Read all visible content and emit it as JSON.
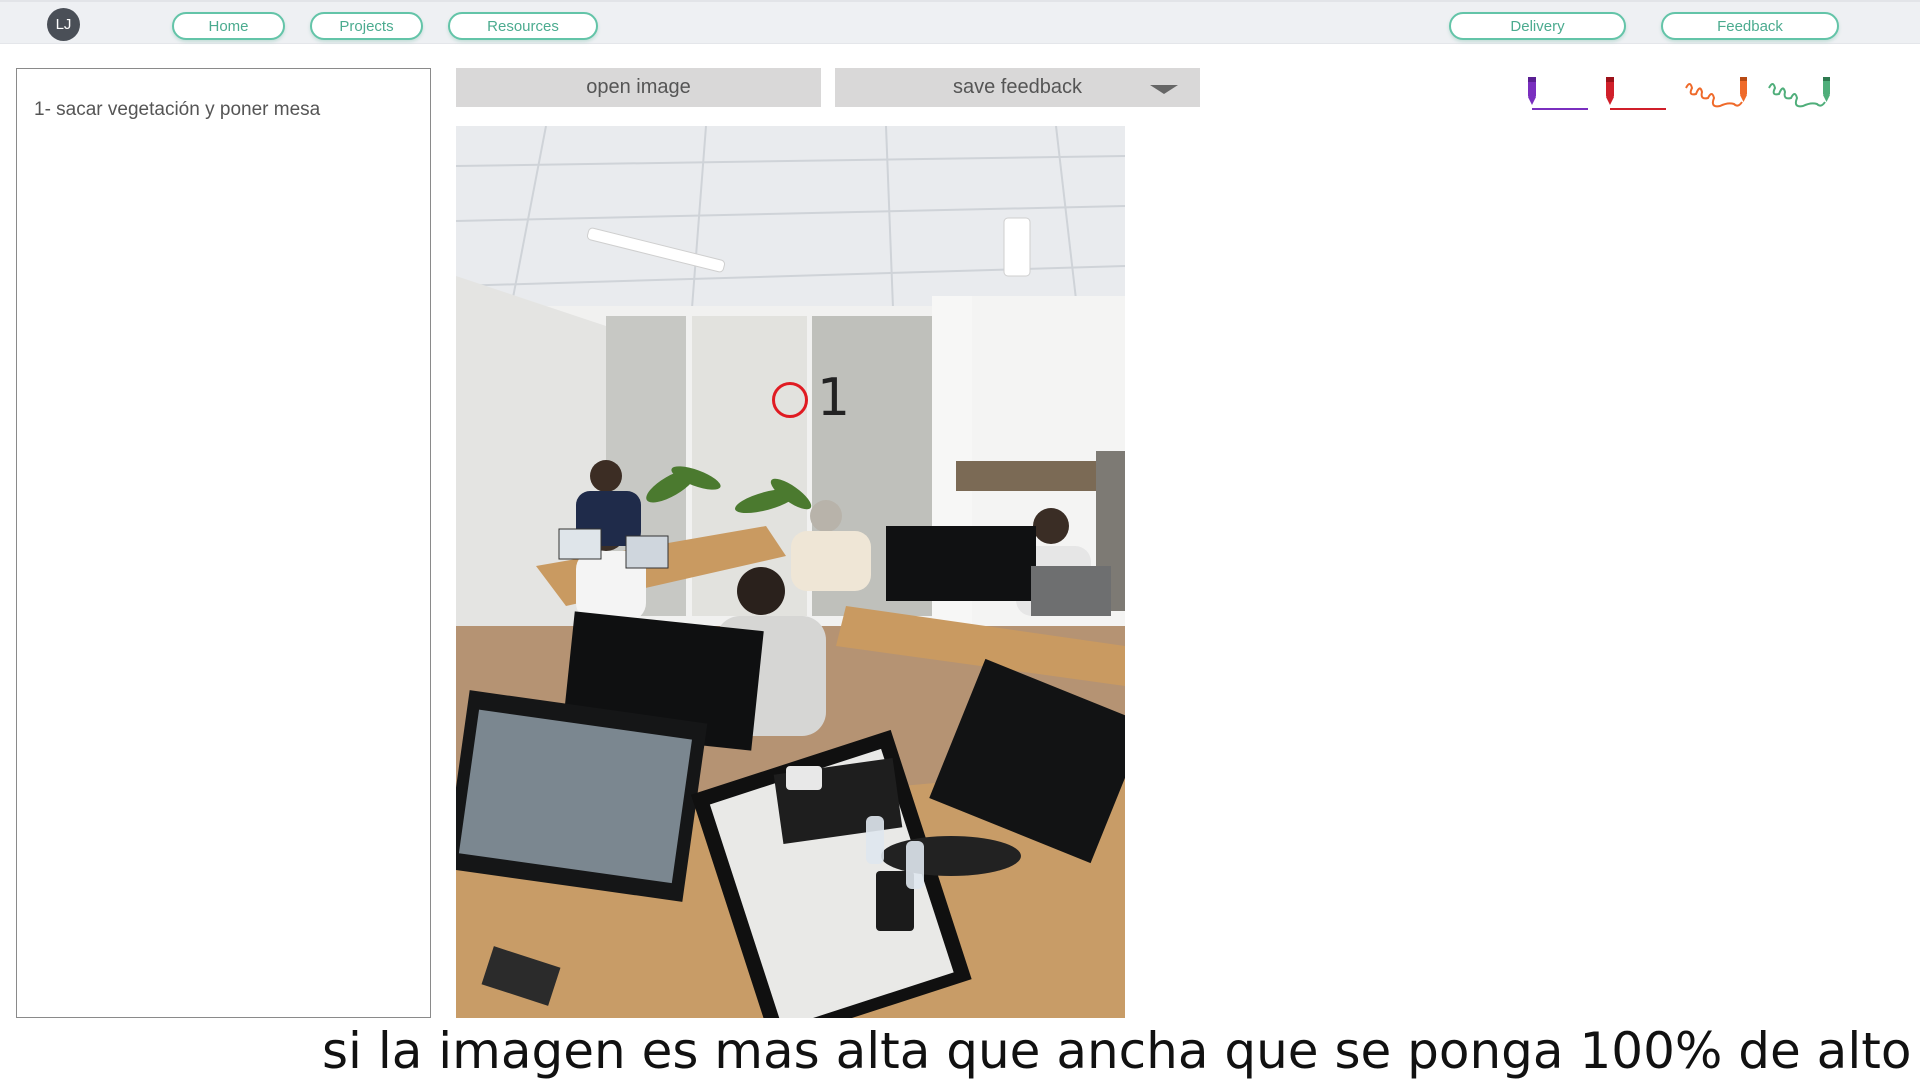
{
  "header": {
    "avatar_initials": "LJ",
    "nav_left": [
      "Home",
      "Projects",
      "Resources"
    ],
    "nav_right": [
      "Delivery",
      "Feedback"
    ],
    "accent_color": "#63c4a8"
  },
  "feedback_list": {
    "items": [
      "1- sacar vegetación y poner mesa"
    ]
  },
  "toolbar": {
    "open_label": "open image",
    "save_label": "save feedback",
    "save_dropdown_icon": "caret-down-icon"
  },
  "tools": [
    {
      "name": "purple-marker-line-icon",
      "color": "#7a2fbf"
    },
    {
      "name": "red-marker-line-icon",
      "color": "#d01f2a"
    },
    {
      "name": "orange-marker-scribble-icon",
      "color": "#ef6a2a"
    },
    {
      "name": "green-marker-scribble-icon",
      "color": "#4fae7a"
    }
  ],
  "canvas": {
    "image": "office-photo",
    "annotation_marker_label": "1",
    "annotation_marker_color": "#e01b22"
  },
  "bottom_note": "si la imagen es mas alta que ancha que se ponga 100% de alto"
}
